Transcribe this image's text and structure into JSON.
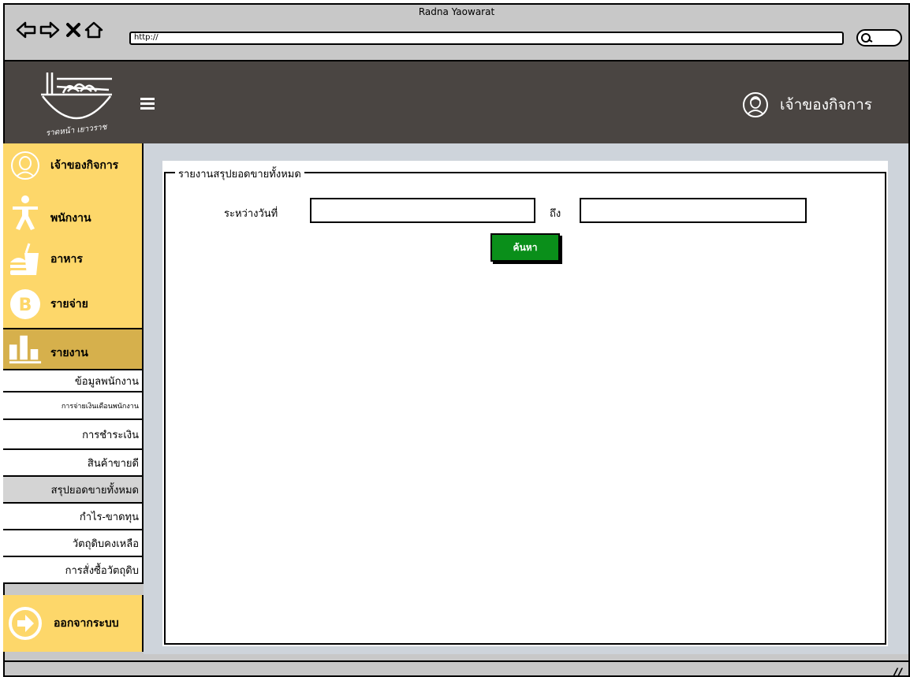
{
  "window": {
    "title": "Radna Yaowarat",
    "url": "http://"
  },
  "header": {
    "user_label": "เจ้าของกิจการ"
  },
  "sidebar": {
    "main_items": [
      {
        "label": "เจ้าของกิจการ",
        "icon": "user-circle-icon"
      },
      {
        "label": "พนักงาน",
        "icon": "person-icon"
      },
      {
        "label": "อาหาร",
        "icon": "food-icon"
      },
      {
        "label": "รายจ่าย",
        "icon": "bitcoin-icon"
      },
      {
        "label": "รายงาน",
        "icon": "bar-chart-icon"
      }
    ],
    "report_items": [
      "ข้อมูลพนักงาน",
      "การจ่ายเงินเดือนพนักงาน",
      "การชำระเงิน",
      "สินค้าขายดี",
      "สรุปยอดขายทั้งหมด",
      "กำไร-ขาดทุน",
      "วัตถุดิบคงเหลือ",
      "การสั่งซื้อวัตถุดิบ"
    ],
    "selected_report": "สรุปยอดขายทั้งหมด",
    "logout_label": "ออกจากระบบ"
  },
  "main": {
    "section_title": "รายงานสรุปยอดขายทั้งหมด",
    "from_label": "ระหว่างวันที่",
    "from_value": "",
    "to_label": "ถึง",
    "to_value": "",
    "search_label": "ค้นหา"
  },
  "colors": {
    "sidebar_bg": "#fdd76a",
    "sidebar_active": "#d6b04c",
    "header_bg": "#4a4542",
    "content_bg": "#ced4db",
    "search_button": "#0a8f1a"
  }
}
